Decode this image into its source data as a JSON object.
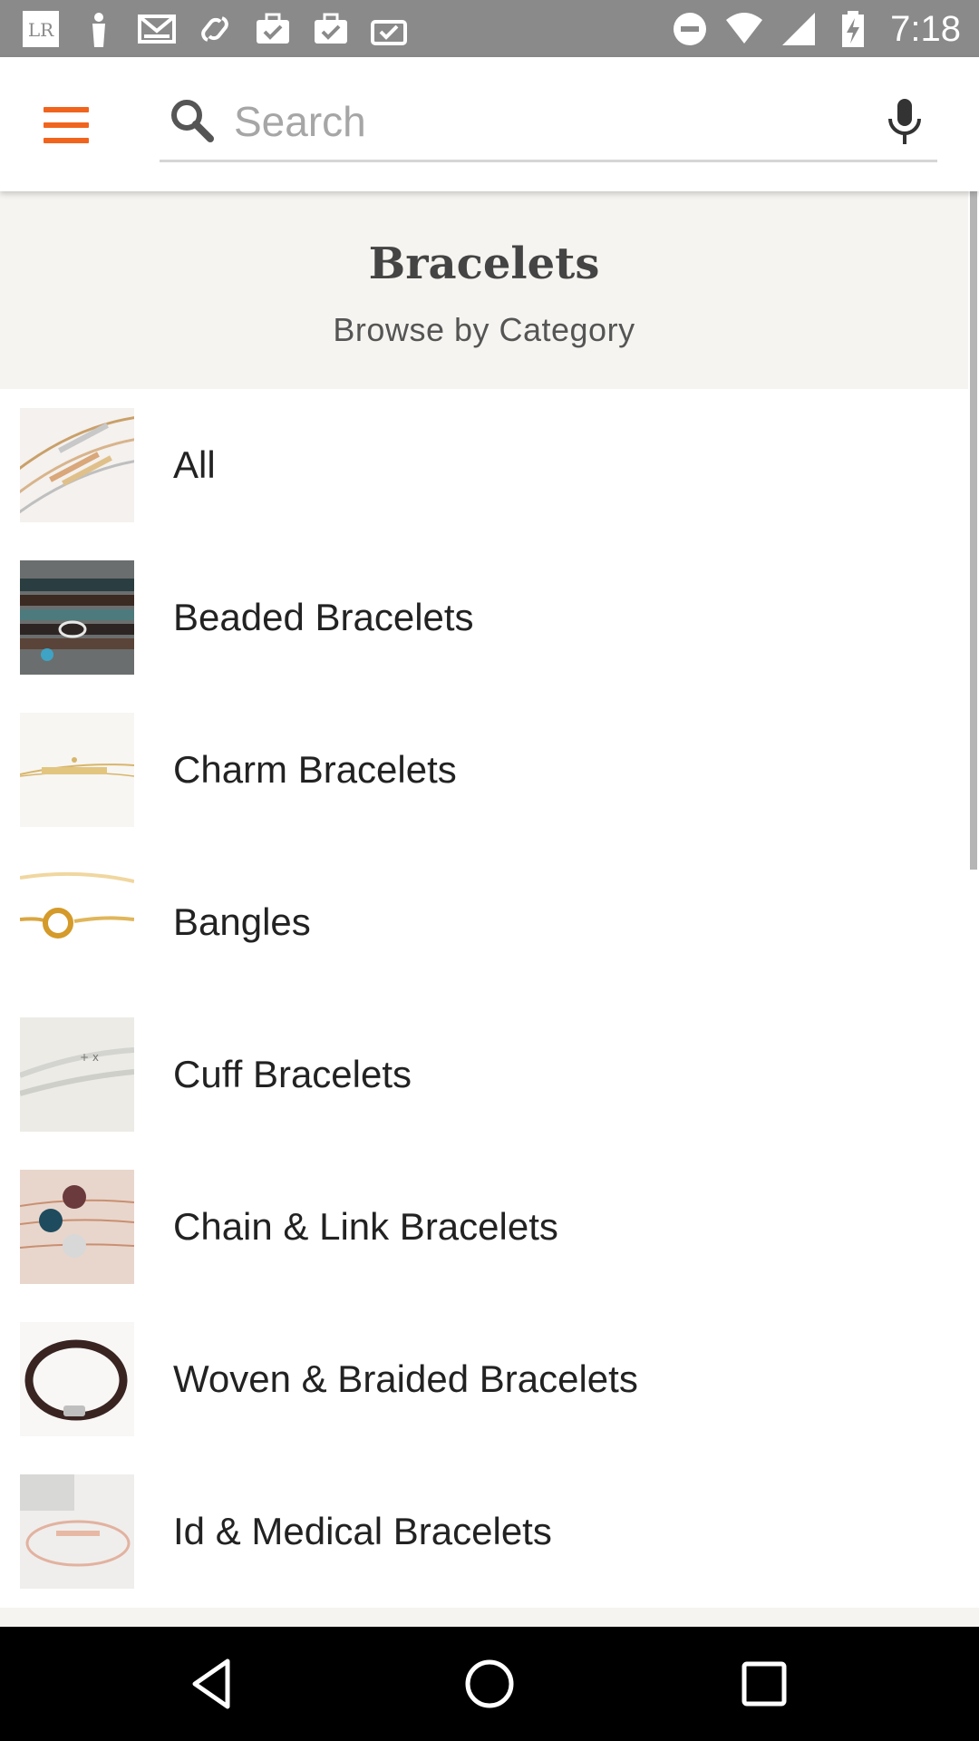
{
  "status_bar": {
    "time": "7:18",
    "left_icons": [
      "lr-app-icon",
      "person-icon",
      "gmail-icon",
      "link-icon",
      "task-check-icon",
      "task-check-icon",
      "task-check-icon"
    ],
    "right_icons": [
      "do-not-disturb-icon",
      "wifi-icon",
      "cell-signal-icon",
      "battery-charging-icon"
    ]
  },
  "header": {
    "menu_icon": "hamburger-menu-icon",
    "search": {
      "placeholder": "Search",
      "value": ""
    },
    "mic_icon": "microphone-icon",
    "accent_color": "#f1641e"
  },
  "banner": {
    "title": "Bracelets",
    "subtitle": "Browse by Category"
  },
  "categories": [
    {
      "label": "All",
      "thumb": "gold-bar-bracelets"
    },
    {
      "label": "Beaded Bracelets",
      "thumb": "stacked-beaded-wraps"
    },
    {
      "label": "Charm Bracelets",
      "thumb": "gold-bar-engraved"
    },
    {
      "label": "Bangles",
      "thumb": "gold-knot-bangle"
    },
    {
      "label": "Cuff Bracelets",
      "thumb": "silver-cuffs"
    },
    {
      "label": "Chain & Link Bracelets",
      "thumb": "druzy-chain-bracelets"
    },
    {
      "label": "Woven & Braided Bracelets",
      "thumb": "braided-leather"
    },
    {
      "label": "Id & Medical Bracelets",
      "thumb": "rose-gold-bar"
    }
  ],
  "nav_bar": {
    "back_icon": "back-triangle-icon",
    "home_icon": "home-circle-icon",
    "recents_icon": "recents-square-icon"
  }
}
